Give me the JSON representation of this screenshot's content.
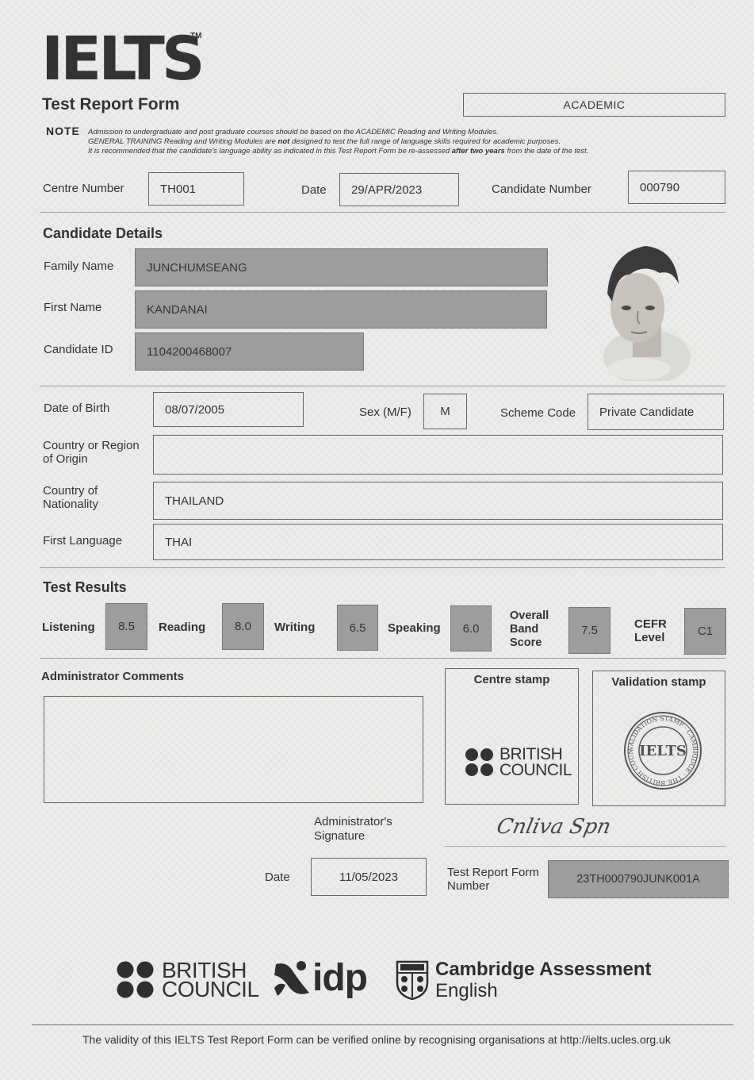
{
  "header": {
    "logo": "IELTS",
    "trademark": "TM",
    "form_title": "Test Report Form",
    "module": "ACADEMIC",
    "note_label": "NOTE",
    "note_line1": "Admission to undergraduate and post graduate courses should be based on the ACADEMIC Reading and Writing Modules.",
    "note_line2a": "GENERAL TRAINING Reading and Writing Modules are ",
    "note_line2b": "not",
    "note_line2c": " designed to test the full range of language skills required for academic purposes.",
    "note_line3a": "It is recommended that the candidate's language ability as indicated in this Test Report Form be re-assessed ",
    "note_line3b": "after two years",
    "note_line3c": " from the date of the test."
  },
  "centre": {
    "centre_number_label": "Centre Number",
    "centre_number": "TH001",
    "date_label": "Date",
    "date": "29/APR/2023",
    "candidate_number_label": "Candidate Number",
    "candidate_number": "000790"
  },
  "candidate": {
    "section_title": "Candidate Details",
    "family_name_label": "Family Name",
    "family_name": "JUNCHUMSEANG",
    "first_name_label": "First Name",
    "first_name": "KANDANAI",
    "candidate_id_label": "Candidate ID",
    "candidate_id": "1104200468007",
    "dob_label": "Date of Birth",
    "dob": "08/07/2005",
    "sex_label": "Sex (M/F)",
    "sex": "M",
    "scheme_code_label": "Scheme Code",
    "scheme_code": "Private Candidate",
    "country_origin_label_1": "Country or Region",
    "country_origin_label_2": "of Origin",
    "country_origin": "",
    "nationality_label_1": "Country of",
    "nationality_label_2": "Nationality",
    "nationality": "THAILAND",
    "first_language_label": "First Language",
    "first_language": "THAI"
  },
  "results": {
    "section_title": "Test Results",
    "listening_label": "Listening",
    "listening": "8.5",
    "reading_label": "Reading",
    "reading": "8.0",
    "writing_label": "Writing",
    "writing": "6.5",
    "speaking_label": "Speaking",
    "speaking": "6.0",
    "overall_label_1": "Overall",
    "overall_label_2": "Band",
    "overall_label_3": "Score",
    "overall": "7.5",
    "cefr_label_1": "CEFR",
    "cefr_label_2": "Level",
    "cefr": "C1"
  },
  "admin": {
    "comments_label": "Administrator Comments",
    "comments": "",
    "centre_stamp_label": "Centre stamp",
    "validation_stamp_label": "Validation stamp",
    "centre_stamp_line1": "BRITISH",
    "centre_stamp_line2": "COUNCIL",
    "validation_stamp_center": "IELTS",
    "validation_stamp_ring": "VALIDATION STAMP · CAMBRIDGE · THE BRITISH COUNCIL ·",
    "signature_label_1": "Administrator's",
    "signature_label_2": "Signature",
    "signature": "Cnliva Spn",
    "date_label": "Date",
    "date": "11/05/2023",
    "trf_label_1": "Test Report Form",
    "trf_label_2": "Number",
    "trf_number": "23TH000790JUNK001A"
  },
  "footer_logos": {
    "bc_line1": "BRITISH",
    "bc_line2": "COUNCIL",
    "idp": "idp",
    "cambridge_line1": "Cambridge Assessment",
    "cambridge_line2": "English"
  },
  "footer": {
    "verification_text": "The validity of this IELTS Test Report Form can be verified online by recognising organisations at http://ielts.ucles.org.uk"
  },
  "colors": {
    "paper": "#ececea",
    "shaded_field": "#9d9e9b",
    "ink": "#2b2b2b"
  }
}
